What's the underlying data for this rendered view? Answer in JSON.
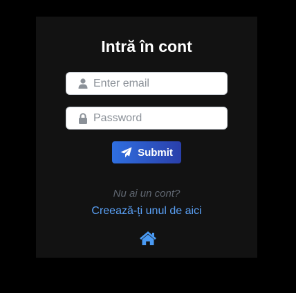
{
  "login": {
    "title": "Intră în cont",
    "email": {
      "placeholder": "Enter email",
      "value": ""
    },
    "password": {
      "placeholder": "Password",
      "value": ""
    },
    "submit_label": "Submit",
    "no_account_text": "Nu ai un cont?",
    "register_link_text": "Creează-ți unul de aici",
    "icons": {
      "email": "user-icon",
      "password": "lock-icon",
      "submit": "paper-plane-icon",
      "home": "home-icon"
    }
  },
  "colors": {
    "page_background": "#000000",
    "card_background": "#121212",
    "accent": "#2f6fe0",
    "link": "#5aa0f5",
    "muted_text": "#5f6670"
  }
}
